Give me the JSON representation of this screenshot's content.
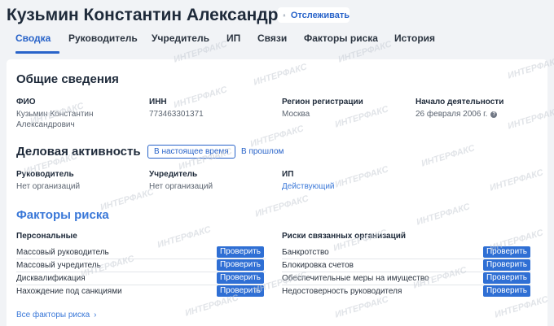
{
  "header": {
    "title": "Кузьмин Константин Александрович",
    "track_label": "Отслеживать"
  },
  "tabs": [
    {
      "label": "Сводка",
      "active": true
    },
    {
      "label": "Руководитель",
      "active": false
    },
    {
      "label": "Учредитель",
      "active": false
    },
    {
      "label": "ИП",
      "active": false
    },
    {
      "label": "Связи",
      "active": false
    },
    {
      "label": "Факторы риска",
      "active": false
    },
    {
      "label": "История",
      "active": false
    }
  ],
  "general": {
    "heading": "Общие сведения",
    "fio_label": "ФИО",
    "fio_line1": "Кузьмин Константин",
    "fio_line2": "Александрович",
    "inn_label": "ИНН",
    "inn_value": "773463301371",
    "region_label": "Регион регистрации",
    "region_value": "Москва",
    "start_label": "Начало деятельности",
    "start_value": "26 февраля 2006 г.",
    "help_glyph": "?"
  },
  "business": {
    "heading": "Деловая активность",
    "period_now": "В настоящее время",
    "period_past": "В прошлом",
    "manager_label": "Руководитель",
    "manager_value": "Нет организаций",
    "founder_label": "Учредитель",
    "founder_value": "Нет организаций",
    "ip_label": "ИП",
    "ip_value": "Действующий"
  },
  "risks": {
    "heading": "Факторы риска",
    "personal_label": "Персональные",
    "related_label": "Риски связанных организаций",
    "check_label": "Проверить",
    "personal": [
      "Массовый руководитель",
      "Массовый учредитель",
      "Дисквалификация",
      "Нахождение под санкциями"
    ],
    "related": [
      "Банкротство",
      "Блокировка счетов",
      "Обеспечительные меры на имущество",
      "Недостоверность руководителя"
    ],
    "all_link": "Все факторы риска",
    "all_chevron": "›"
  },
  "watermark": "ИНТЕРФАКС",
  "colors": {
    "accent": "#2863c9",
    "button_bg": "#2f6fd4",
    "section_blue": "#3a78d8",
    "page_bg": "#f1f3f6"
  }
}
